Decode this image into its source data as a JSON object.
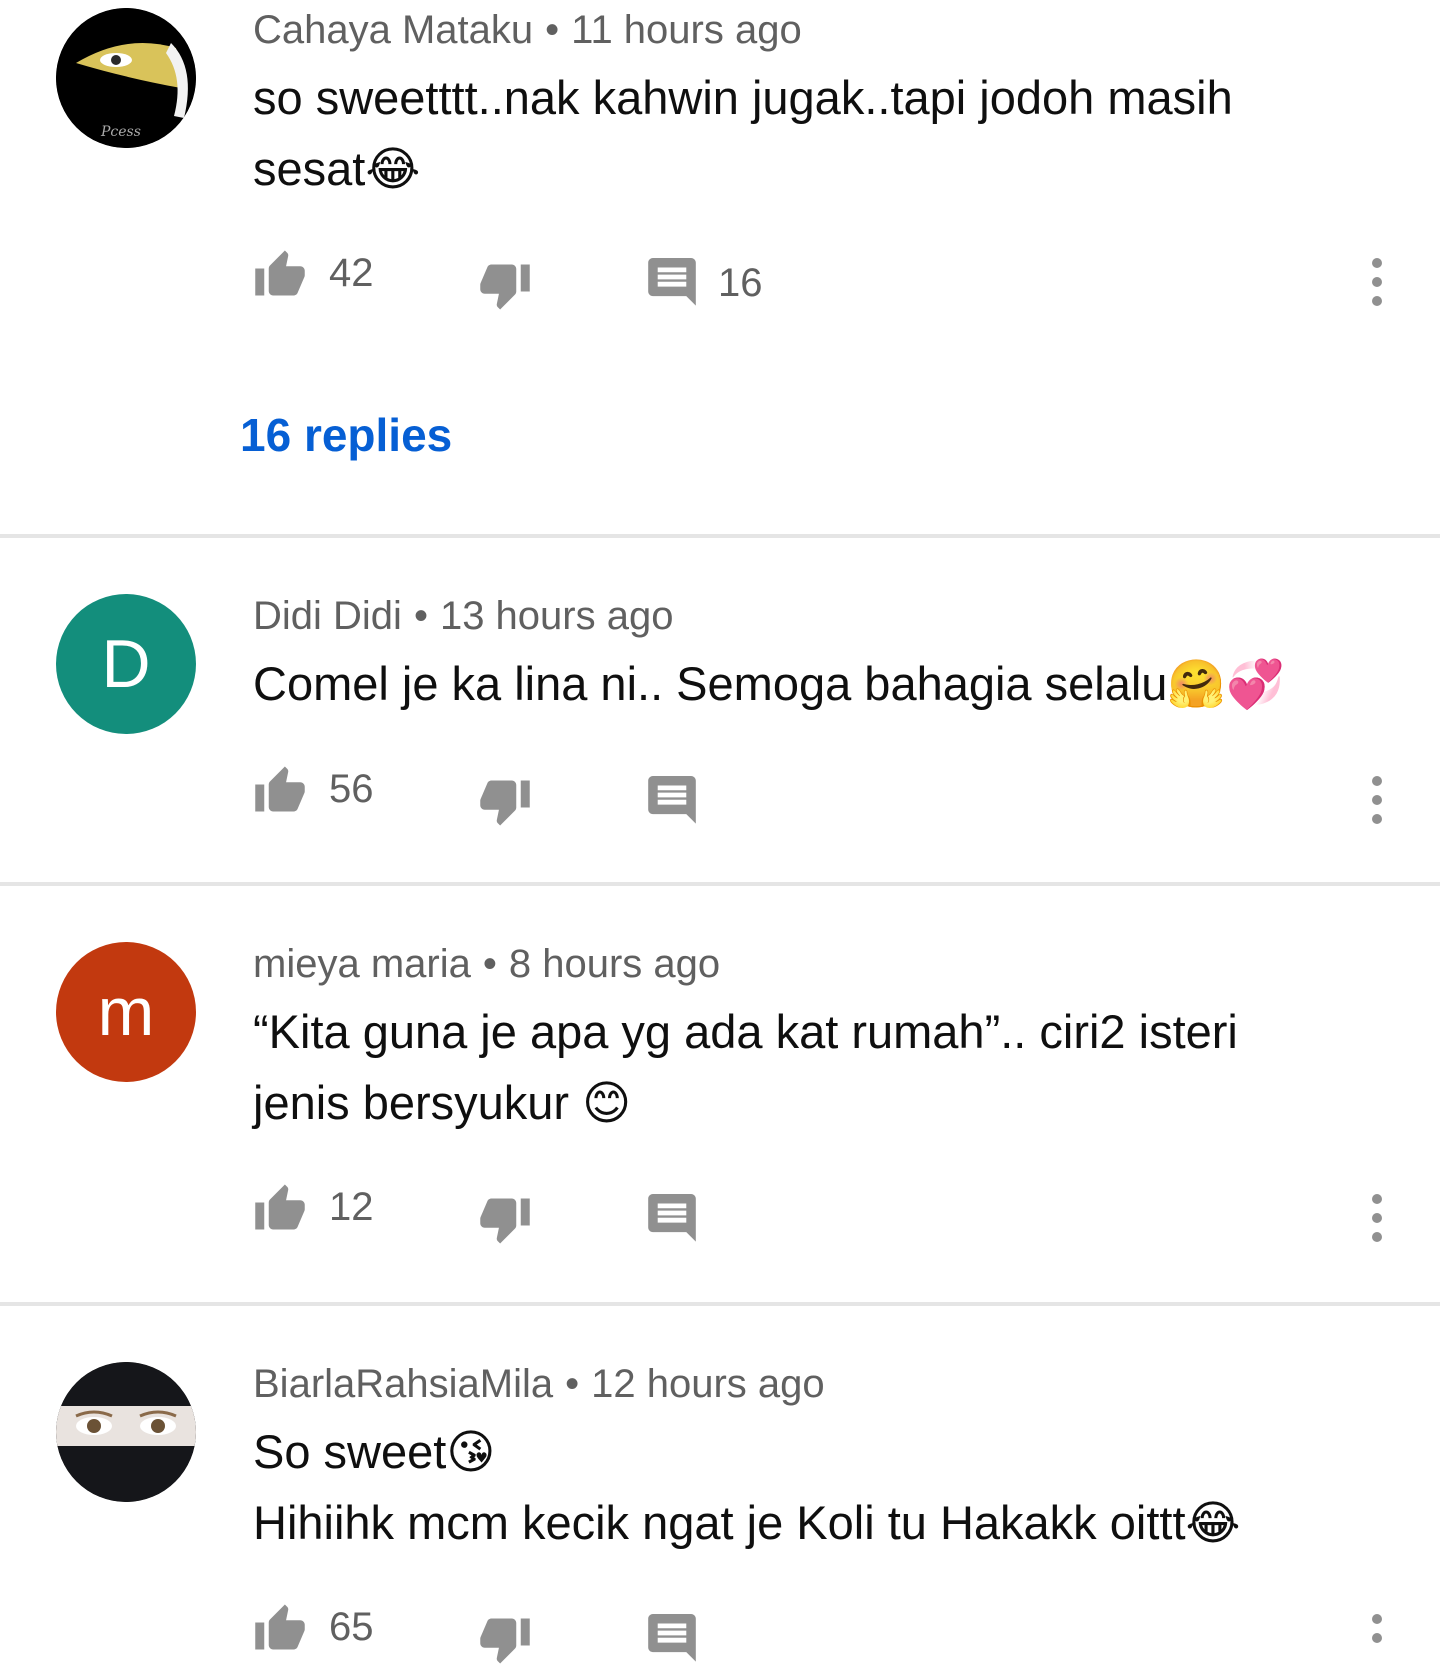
{
  "comments": [
    {
      "author": "Cahaya Mataku",
      "time": "11 hours ago",
      "lines": [
        "so sweetttt..nak kahwin jugak..tapi jodoh masih",
        "sesat😂"
      ],
      "likes": "42",
      "reply_count": "16",
      "replies_link": "16 replies",
      "avatar": {
        "type": "image",
        "description_icon": "veiled-face-icon",
        "bg": "#000000"
      }
    },
    {
      "author": "Didi Didi",
      "time": "13 hours ago",
      "lines": [
        "Comel je ka lina ni.. Semoga bahagia selalu🤗💞"
      ],
      "likes": "56",
      "avatar": {
        "type": "letter",
        "letter": "D",
        "bg": "#138e7c"
      }
    },
    {
      "author": "mieya maria",
      "time": "8 hours ago",
      "lines": [
        "“Kita guna je apa yg ada kat rumah”.. ciri2 isteri",
        "jenis bersyukur 😊"
      ],
      "likes": "12",
      "avatar": {
        "type": "letter",
        "letter": "m",
        "bg": "#c2390f"
      }
    },
    {
      "author": "BiarlaRahsiaMila",
      "time": "12 hours ago",
      "lines": [
        "So sweet😘",
        "Hihiihk mcm kecik ngat je Koli tu Hakakk oittt😂"
      ],
      "likes": "65",
      "avatar": {
        "type": "image",
        "description_icon": "veiled-face-icon",
        "bg": "#1a1a1a"
      }
    }
  ],
  "separator": "•",
  "colors": {
    "meta": "#606060",
    "link": "#065fd4",
    "icon": "#909090",
    "divider": "#e5e5e5"
  }
}
